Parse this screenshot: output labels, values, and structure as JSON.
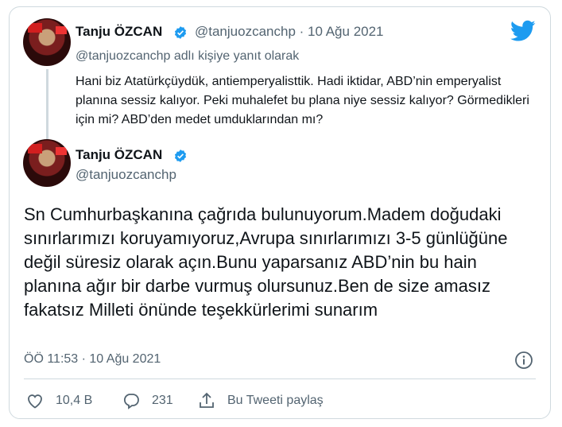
{
  "reply_tweet": {
    "name": "Tanju ÖZCAN",
    "handle": "@tanjuozcanchp",
    "date": "· 10 Ağu 2021",
    "reply_to": "@tanjuozcanchp adlı kişiye yanıt olarak",
    "text": "Hani biz Atatürkçüydük, antiemperyalisttik. Hadi iktidar, ABD’nin emperyalist planına sessiz kalıyor. Peki muhalefet bu plana niye sessiz kalıyor? Görmedikleri için mi? ABD’den medet umduklarından mı?"
  },
  "main_tweet": {
    "name": "Tanju ÖZCAN",
    "handle": "@tanjuozcanchp",
    "text": "Sn Cumhurbaşkanına çağrıda bulunuyorum.Madem doğudaki sınırlarımızı koruyamıyoruz,Avrupa sınırlarımızı 3-5 günlüğüne değil süresiz olarak açın.Bunu yaparsanız ABD’nin bu hain planına ağır bir darbe vurmuş olursunuz.Ben de size amasız fakatsız Milleti önünde teşekkürlerimi sunarım",
    "timestamp": "ÖÖ 11:53 · 10 Ağu 2021"
  },
  "actions": {
    "likes": "10,4 B",
    "replies": "231",
    "share_label": "Bu Tweeti paylaş"
  },
  "colors": {
    "twitter_blue": "#1d9bf0",
    "secondary_text": "#536471",
    "border": "#cfd9de"
  },
  "icons": [
    "verified-badge-icon",
    "twitter-bird-icon",
    "info-icon",
    "heart-icon",
    "reply-icon",
    "share-icon"
  ]
}
